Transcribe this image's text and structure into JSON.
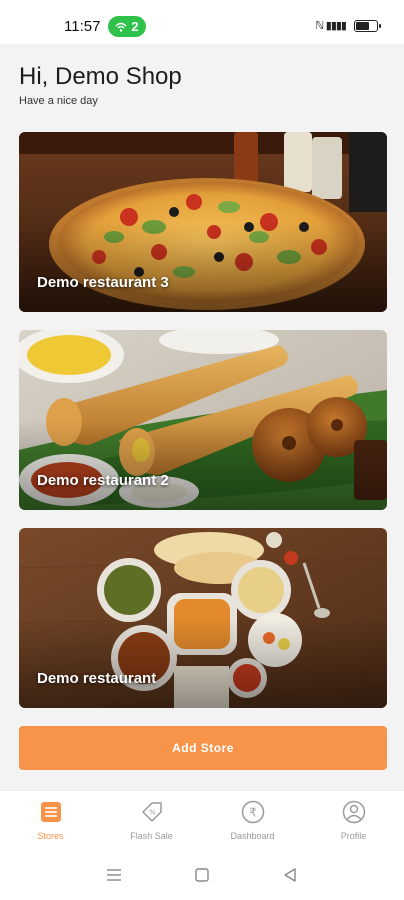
{
  "status": {
    "time": "11:57",
    "wifi_count": "2",
    "battery_level": 0.6
  },
  "header": {
    "greeting": "Hi, Demo Shop",
    "subtitle": "Have a nice day"
  },
  "stores": [
    {
      "name": "Demo restaurant 3",
      "image": "pizza"
    },
    {
      "name": "Demo restaurant 2",
      "image": "dosa-vada"
    },
    {
      "name": "Demo restaurant",
      "image": "indian-thali"
    }
  ],
  "add_store_label": "Add Store",
  "nav": [
    {
      "label": "Stores",
      "icon": "store-list-icon",
      "active": true
    },
    {
      "label": "Flash Sale",
      "icon": "flash-sale-tag-icon",
      "active": false
    },
    {
      "label": "Dashboard",
      "icon": "rupee-icon",
      "active": false
    },
    {
      "label": "Profile",
      "icon": "profile-icon",
      "active": false
    }
  ],
  "colors": {
    "accent": "#f7944a",
    "background": "#f3f3f3",
    "wifi_pill": "#2ec24a"
  }
}
